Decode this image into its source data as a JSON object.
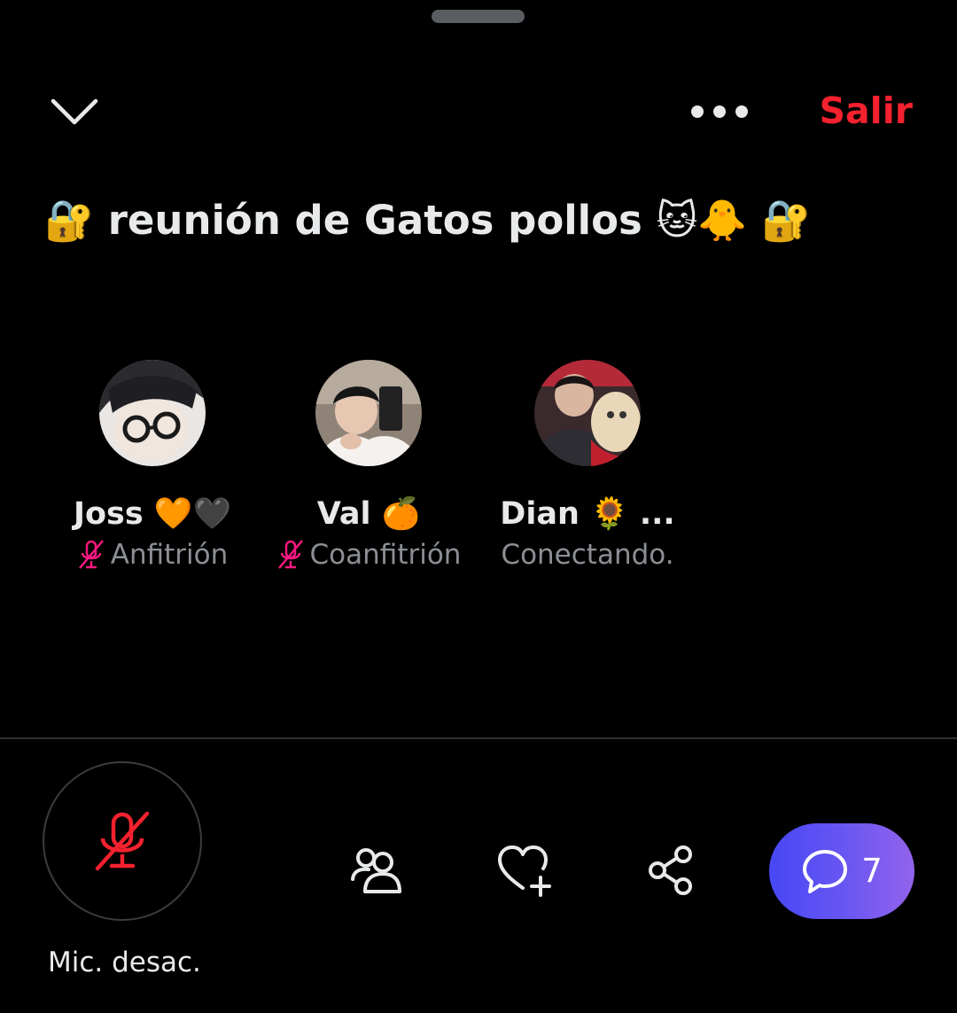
{
  "header": {
    "collapse_icon": "chevron-down-icon",
    "more_icon": "more-horizontal-icon",
    "leave_label": "Salir",
    "leave_color": "#f4212e"
  },
  "space": {
    "title": "🔐 reunión de Gatos pollos 🐱🐥 🔐"
  },
  "participants": [
    {
      "name": "Joss 🧡🖤",
      "role": "Anfitrión",
      "muted": true
    },
    {
      "name": "Val 🍊",
      "role": "Coanfitrión",
      "muted": true
    },
    {
      "name": "Dian 🌻 ...",
      "role": "Conectando.",
      "muted": false
    }
  ],
  "footer": {
    "mic_label": "Mic. desac.",
    "mic_icon": "mic-off-icon",
    "people_icon": "people-icon",
    "react_icon": "heart-plus-icon",
    "share_icon": "share-icon",
    "reply_icon": "speech-bubble-icon",
    "reply_count": "7",
    "accent_gradient": [
      "#4747f5",
      "#9463ec"
    ],
    "muted_color": "#f91880"
  }
}
